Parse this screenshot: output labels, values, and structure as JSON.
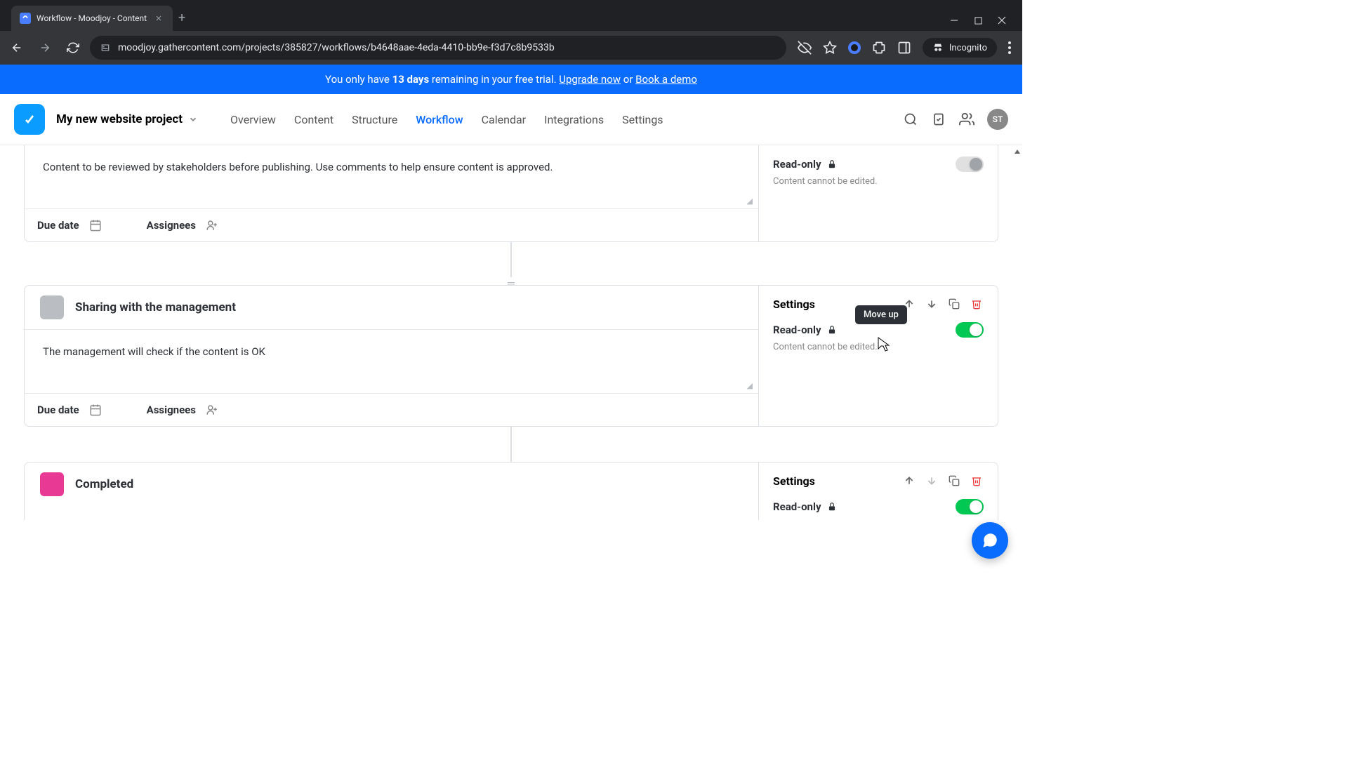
{
  "browser": {
    "tab_title": "Workflow - Moodjoy - Content",
    "url": "moodjoy.gathercontent.com/projects/385827/workflows/b4648aae-4eda-4410-bb9e-f3d7c8b9533b",
    "incognito_label": "Incognito"
  },
  "trial": {
    "prefix": "You only have ",
    "days": "13 days",
    "middle": " remaining in your free trial. ",
    "upgrade": "Upgrade now",
    "or": " or ",
    "demo": "Book a demo"
  },
  "header": {
    "project_name": "My new website project",
    "nav": [
      "Overview",
      "Content",
      "Structure",
      "Workflow",
      "Calendar",
      "Integrations",
      "Settings"
    ],
    "active_nav_index": 3,
    "avatar_initials": "ST"
  },
  "workflow": {
    "due_date_label": "Due date",
    "assignees_label": "Assignees",
    "settings_label": "Settings",
    "readonly_label": "Read-only",
    "readonly_hint": "Content cannot be edited.",
    "tooltip_move_up": "Move up",
    "steps": [
      {
        "description": "Content to be reviewed by stakeholders before publishing. Use comments to help ensure content is approved.",
        "readonly": false
      },
      {
        "title": "Sharing with the management",
        "description": "The management will check if the content is OK",
        "readonly": true,
        "swatch": "grey"
      },
      {
        "title": "Completed",
        "readonly": true,
        "swatch": "pink"
      }
    ]
  }
}
